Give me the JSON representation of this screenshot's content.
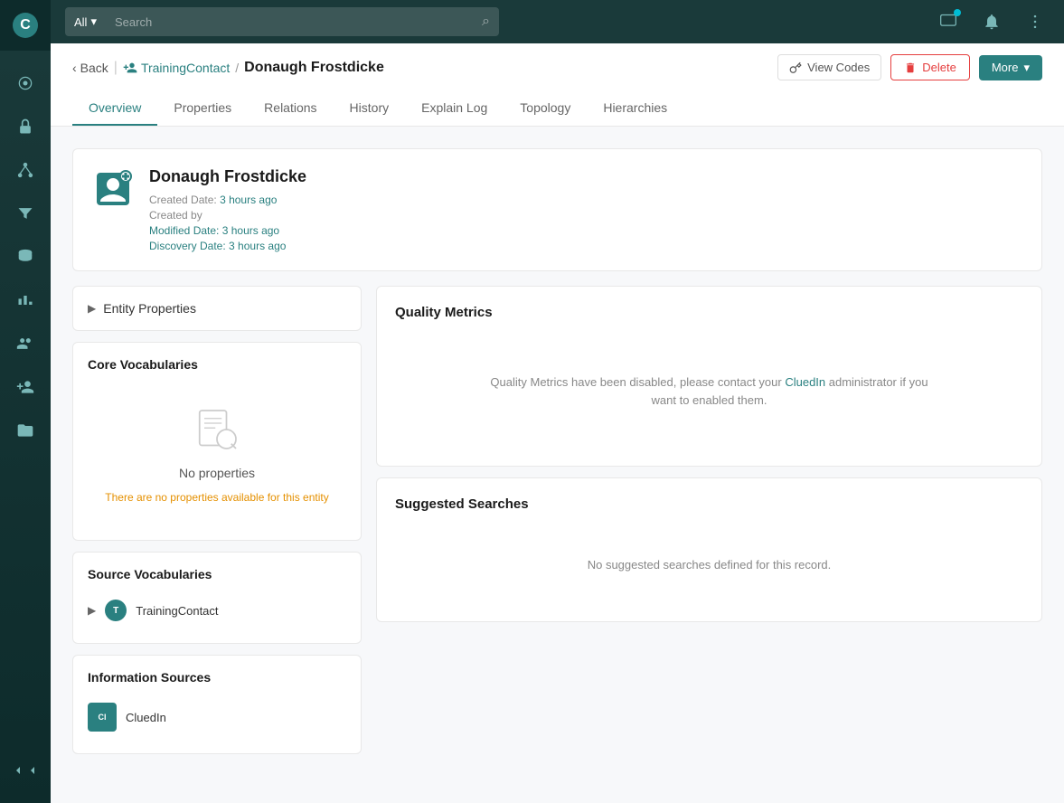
{
  "sidebar": {
    "logo": "C",
    "items": [
      {
        "name": "home-icon",
        "label": "Home"
      },
      {
        "name": "lock-icon",
        "label": "Lock"
      },
      {
        "name": "network-icon",
        "label": "Network"
      },
      {
        "name": "filter-icon",
        "label": "Filter"
      },
      {
        "name": "database-icon",
        "label": "Database"
      },
      {
        "name": "users-icon",
        "label": "Users"
      },
      {
        "name": "person-add-icon",
        "label": "Person Add"
      },
      {
        "name": "folder-icon",
        "label": "Folder"
      }
    ],
    "expand_label": "<<"
  },
  "topbar": {
    "search_placeholder": "Search",
    "search_dropdown_label": "All",
    "icons": [
      "monitor-icon",
      "bell-icon",
      "dots-icon"
    ]
  },
  "breadcrumb": {
    "back_label": "Back",
    "parent_label": "TrainingContact",
    "current_label": "Donaugh Frostdicke"
  },
  "header_actions": {
    "view_codes_label": "View Codes",
    "delete_label": "Delete",
    "more_label": "More"
  },
  "tabs": [
    {
      "label": "Overview",
      "active": true
    },
    {
      "label": "Properties",
      "active": false
    },
    {
      "label": "Relations",
      "active": false
    },
    {
      "label": "History",
      "active": false
    },
    {
      "label": "Explain Log",
      "active": false
    },
    {
      "label": "Topology",
      "active": false
    },
    {
      "label": "Hierarchies",
      "active": false
    }
  ],
  "entity": {
    "name": "Donaugh Frostdicke",
    "created_date_label": "Created Date:",
    "created_date_value": "3 hours ago",
    "created_by_label": "Created by",
    "modified_date_label": "Modified Date:",
    "modified_date_value": "3 hours ago",
    "discovery_date_label": "Discovery Date:",
    "discovery_date_value": "3 hours ago"
  },
  "entity_properties": {
    "title": "Entity Properties"
  },
  "core_vocabularies": {
    "title": "Core Vocabularies",
    "empty_label": "No properties",
    "empty_desc": "There are no properties available for this entity"
  },
  "source_vocabularies": {
    "title": "Source Vocabularies",
    "items": [
      {
        "name": "TrainingContact",
        "icon_text": "T"
      }
    ]
  },
  "information_sources": {
    "title": "Information Sources",
    "items": [
      {
        "name": "CluedIn",
        "icon_text": "Cl"
      }
    ]
  },
  "quality_metrics": {
    "title": "Quality Metrics",
    "message": "Quality Metrics have been disabled, please contact your CluedIn administrator if you want to enabled them."
  },
  "suggested_searches": {
    "title": "Suggested Searches",
    "message": "No suggested searches defined for this record."
  },
  "colors": {
    "primary": "#2a8080",
    "warning": "#e59000",
    "danger": "#e53e3e"
  }
}
